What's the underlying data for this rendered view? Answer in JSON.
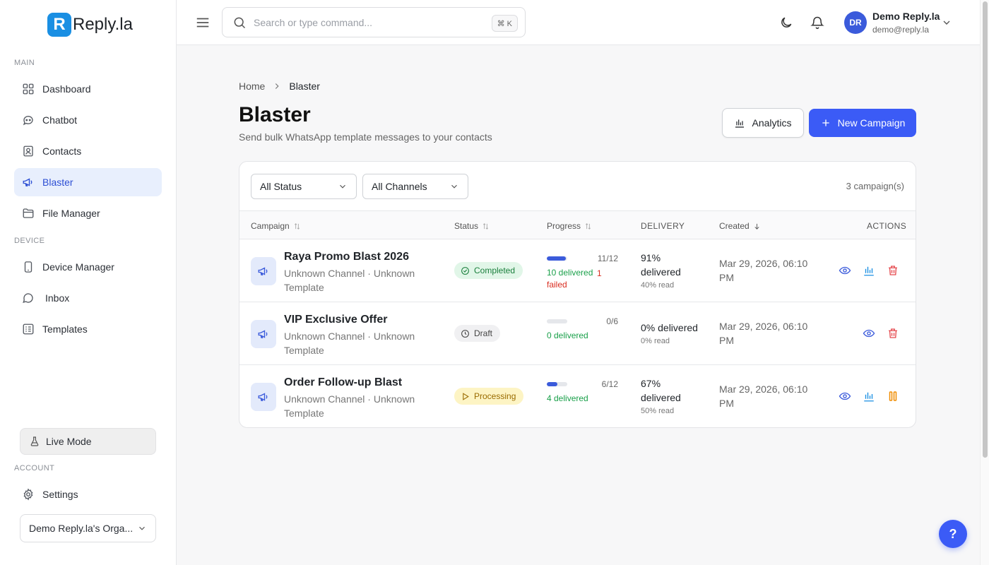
{
  "brand": {
    "mark": "R",
    "name": "Reply.la"
  },
  "sidebar": {
    "sections": {
      "main": "MAIN",
      "device": "DEVICE",
      "account": "ACCOUNT"
    },
    "items": [
      {
        "label": "Dashboard",
        "icon": "grid-icon"
      },
      {
        "label": "Chatbot",
        "icon": "chatbot-icon"
      },
      {
        "label": "Contacts",
        "icon": "contacts-icon"
      },
      {
        "label": "Blaster",
        "icon": "megaphone-icon",
        "active": true
      },
      {
        "label": "File Manager",
        "icon": "folder-icon"
      },
      {
        "label": "Device Manager",
        "icon": "smartphone-icon"
      },
      {
        "label": "Inbox",
        "icon": "chat-bubble-icon"
      },
      {
        "label": "Templates",
        "icon": "template-icon"
      },
      {
        "label": "Settings",
        "icon": "gear-icon"
      }
    ],
    "live_mode": "Live Mode",
    "org": "Demo Reply.la's Orga..."
  },
  "header": {
    "search_placeholder": "Search or type command...",
    "shortcut": "⌘ K",
    "user": {
      "initials": "DR",
      "name": "Demo Reply.la",
      "email": "demo@reply.la"
    }
  },
  "breadcrumb": {
    "home": "Home",
    "current": "Blaster"
  },
  "page": {
    "title": "Blaster",
    "subtitle": "Send bulk WhatsApp template messages to your contacts",
    "analytics_label": "Analytics",
    "new_campaign_label": "New Campaign"
  },
  "filters": {
    "status": "All Status",
    "channels": "All Channels",
    "count": "3 campaign(s)"
  },
  "table": {
    "columns": {
      "campaign": "Campaign",
      "status": "Status",
      "progress": "Progress",
      "delivery": "DELIVERY",
      "created": "Created",
      "actions": "ACTIONS"
    },
    "rows": [
      {
        "name": "Raya Promo Blast 2026",
        "meta": "Unknown Channel · Unknown Template",
        "status": "Completed",
        "progress_fraction": 0.92,
        "progress_text": "11/12",
        "delivered_text": "10 delivered",
        "failed_text": "1 failed",
        "delivery_main": "91% delivered",
        "delivery_read": "40% read",
        "created": "Mar 29, 2026, 06:10 PM"
      },
      {
        "name": "VIP Exclusive Offer",
        "meta": "Unknown Channel · Unknown Template",
        "status": "Draft",
        "progress_fraction": 0,
        "progress_text": "0/6",
        "delivered_text": "0 delivered",
        "delivery_main": "0% delivered",
        "delivery_read": "0% read",
        "created": "Mar 29, 2026, 06:10 PM"
      },
      {
        "name": "Order Follow-up Blast",
        "meta": "Unknown Channel · Unknown Template",
        "status": "Processing",
        "progress_fraction": 0.5,
        "progress_text": "6/12",
        "delivered_text": "4 delivered",
        "delivery_main": "67% delivered",
        "delivery_read": "50% read",
        "created": "Mar 29, 2026, 06:10 PM"
      }
    ]
  },
  "help_label": "?",
  "colors": {
    "accent": "#3b5bf6",
    "completed": "#1a7f3c",
    "processing": "#9a6b00",
    "danger": "#d92d20",
    "success": "#1aa04a"
  }
}
